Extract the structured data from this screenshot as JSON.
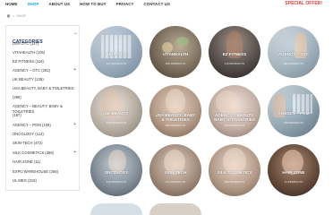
{
  "nav": {
    "links": [
      "HOME",
      "SHOP",
      "ABOUT US",
      "HOW TO BUY",
      "PRIVACY",
      "CONTACT US"
    ],
    "active": "SHOP",
    "offer": "SPECIAL OFFER!",
    "offer_color": "#e23b3b",
    "accent": "#0aa4d6"
  },
  "breadcrumb": {
    "sep": ">",
    "current": "SHOP"
  },
  "sidebar": {
    "title": "CATEGORIES",
    "toggle": "−",
    "items": [
      {
        "label": "USA OTC (117)",
        "toggle": ""
      },
      {
        "label": "VITAHEALTH (105)",
        "toggle": ""
      },
      {
        "label": "EZ FITNESS (119)",
        "toggle": ""
      },
      {
        "label": "AGENCY – OTC (282)",
        "toggle": "+"
      },
      {
        "label": "UK BEAUTY (135)",
        "toggle": ""
      },
      {
        "label": "USA BEAUTY, BABY & TOILETRIES",
        "toggle": ""
      },
      {
        "label": "(366)",
        "toggle": ""
      },
      {
        "label": "AGENCY – BEAUTY, BABY & TOILETRIES",
        "toggle": ""
      },
      {
        "label": "(197)",
        "toggle": ""
      },
      {
        "label": "AGENCY – POM (109)",
        "toggle": "+"
      },
      {
        "label": "ONCOLOGY (113)",
        "toggle": ""
      },
      {
        "label": "SKIN-TECH (472)",
        "toggle": ""
      },
      {
        "label": "SILK COSMETICS (356)",
        "toggle": "+"
      },
      {
        "label": "HAIR ZONE (11)",
        "toggle": ""
      },
      {
        "label": "EXPO WAREHOUSE (256)",
        "toggle": ""
      },
      {
        "label": "UL MEG (218)",
        "toggle": ""
      }
    ]
  },
  "tiles": [
    {
      "label": "USA OTC",
      "count": "117 PRODUCTS",
      "bg": "#b8c8d8"
    },
    {
      "label": "VITAHEALTH",
      "count": "105 PRODUCTS",
      "bg": "#8a7d6a"
    },
    {
      "label": "EZ FITNESS",
      "count": "119 PRODUCTS",
      "bg": "#6b6663"
    },
    {
      "label": "AGENCY – OTC",
      "count": "282 PRODUCTS",
      "bg": "#a7b7c3"
    },
    {
      "label": "UK BEAUTY",
      "count": "135 PRODUCTS",
      "bg": "#c9bdb1"
    },
    {
      "label": "USA BEAUTY, BABY & TOILETRIES",
      "count": "366 PRODUCTS",
      "bg": "#c6a892"
    },
    {
      "label": "AGENCY – BEAUTY, BABY & TOILETRIES",
      "count": "197 PRODUCTS",
      "bg": "#d8c1b5"
    },
    {
      "label": "AGENCY – POM",
      "count": "109 PRODUCTS",
      "bg": "#9fb6c3"
    },
    {
      "label": "ONCOLOGY",
      "count": "113 PRODUCTS",
      "bg": "#8d9aa6"
    },
    {
      "label": "SKIN-TECH",
      "count": "472 PRODUCTS",
      "bg": "#b29886"
    },
    {
      "label": "SILK COSMETICS",
      "count": "356 PRODUCTS",
      "bg": "#c7aa95"
    },
    {
      "label": "HAIR ZONE",
      "count": "11 PRODUCTS",
      "bg": "#6e4f3c"
    }
  ]
}
